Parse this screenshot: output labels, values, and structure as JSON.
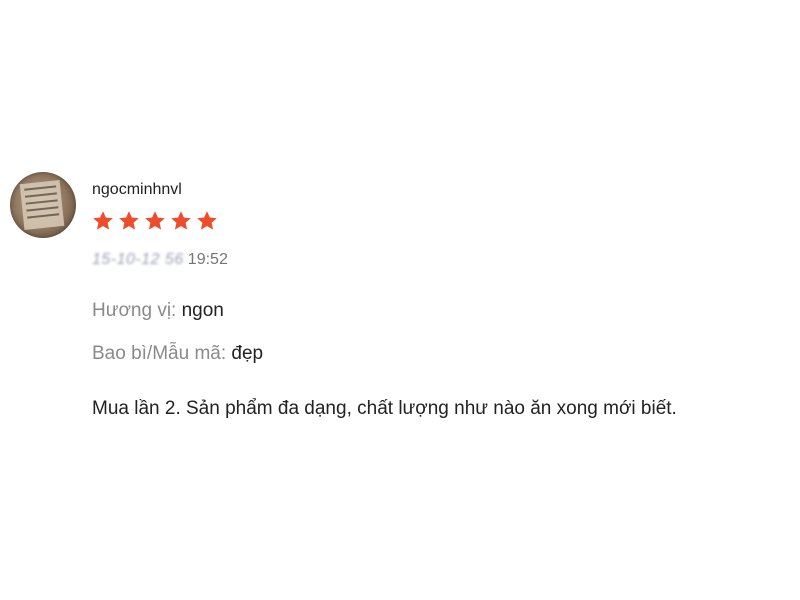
{
  "review": {
    "username": "ngocminhnvl",
    "rating": 5,
    "rating_max": 5,
    "star_color": "#ee4d2d",
    "star_icon": "star-filled-icon",
    "date_redacted": "15-10-12 56",
    "time": "19:52",
    "attributes": [
      {
        "label": "Hương vị:",
        "value": "ngon"
      },
      {
        "label": "Bao bì/Mẫu mã:",
        "value": "đẹp"
      }
    ],
    "comment": "Mua lần 2. Sản phẩm đa dạng, chất lượng như nào ăn xong mới biết."
  }
}
